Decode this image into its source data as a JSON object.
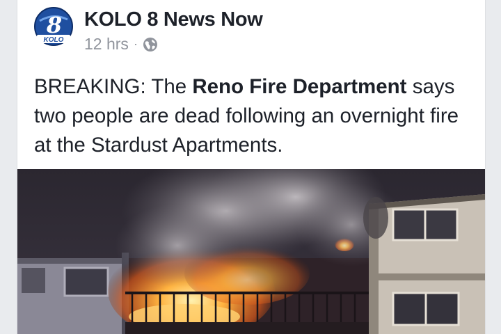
{
  "post": {
    "page_name": "KOLO 8 News Now",
    "timestamp": "12 hrs",
    "separator": "·",
    "privacy_icon": "globe-icon",
    "avatar_logo": {
      "number": "8",
      "wordmark": "KOLO"
    },
    "text": {
      "prefix": "BREAKING: The ",
      "bold": "Reno Fire Department",
      "suffix": " says two people are dead following an overnight fire at the Stardust Apartments."
    },
    "photo_icon": "apartment-fire-photo"
  },
  "colors": {
    "name": "#1d2129",
    "meta": "#90949c",
    "logo_blue": "#1f4fa0"
  }
}
